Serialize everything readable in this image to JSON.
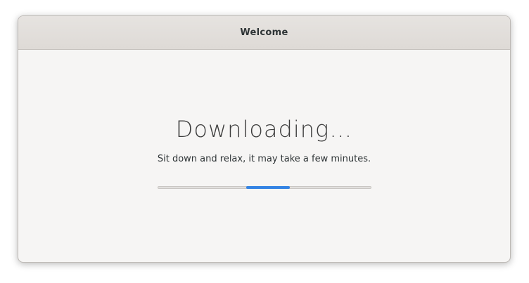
{
  "window": {
    "title": "Welcome"
  },
  "main": {
    "heading": "Downloading…",
    "subtitle": "Sit down and relax, it may take a few minutes."
  },
  "progress": {
    "mode": "indeterminate",
    "block_start": 0.415,
    "block_end": 0.62,
    "color": "#3584e4"
  }
}
